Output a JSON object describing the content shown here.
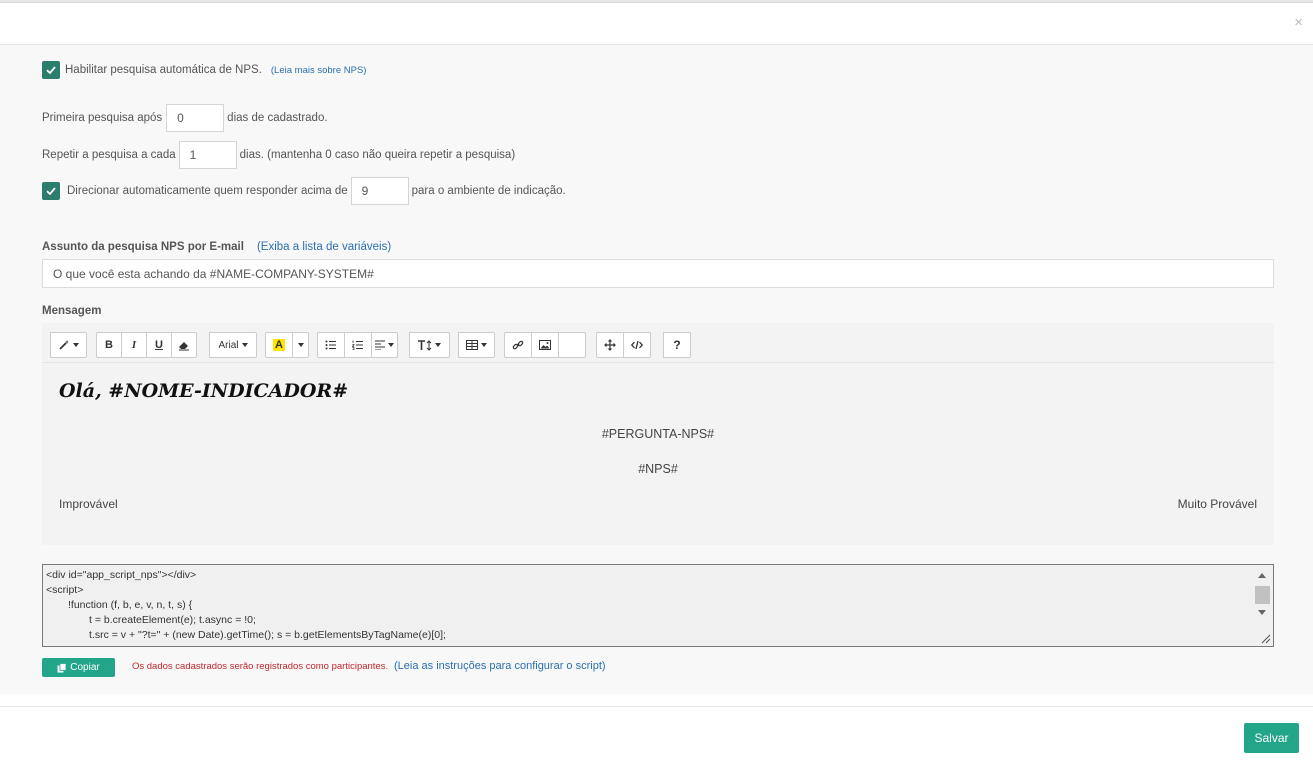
{
  "dialog": {
    "close_label": "×"
  },
  "nps": {
    "enable_label": "Habilitar pesquisa automática de NPS.",
    "enable_link": "(Leia mais sobre NPS)",
    "first_prefix": "Primeira pesquisa após",
    "first_value": "0",
    "first_suffix": "dias de cadastrado.",
    "repeat_prefix": "Repetir a pesquisa a cada",
    "repeat_value": "1",
    "repeat_suffix": "dias. (mantenha 0 caso não queira repetir a pesquisa)",
    "redirect_prefix": "Direcionar automaticamente quem responder acima de",
    "redirect_value": "9",
    "redirect_suffix": "para o ambiente de indicação."
  },
  "subject": {
    "label": "Assunto da pesquisa NPS por E-mail",
    "vars_link": "(Exiba a lista de variáveis)",
    "value": "O que você esta achando da #NAME-COMPANY-SYSTEM#"
  },
  "message": {
    "label": "Mensagem",
    "toolbar": {
      "font_name": "Arial",
      "bold": "B",
      "italic": "I",
      "underline": "U",
      "text_color": "A",
      "help": "?"
    },
    "greeting": "Olá, #NOME-INDICADOR#",
    "question": "#PERGUNTA-NPS#",
    "nps": "#NPS#",
    "left_label": "Improvável",
    "right_label": "Muito Provável"
  },
  "script": {
    "lines": [
      "<div id=\"app_script_nps\"></div>",
      "<script>",
      "!function (f, b, e, v, n, t, s) {",
      "t = b.createElement(e); t.async = !0;",
      "t.src = v + \"?t=\" + (new Date).getTime(); s = b.getElementsByTagName(e)[0];"
    ],
    "copy_label": "Copiar",
    "note": "Os dados cadastrados serão registrados como participantes.",
    "instructions_link": "(Leia as instruções para configurar o script)"
  },
  "footer": {
    "save_label": "Salvar"
  },
  "colors": {
    "accent": "#22a588",
    "checkbox": "#2a7e6b",
    "link": "#2a6fb0",
    "error": "#c0272d"
  }
}
